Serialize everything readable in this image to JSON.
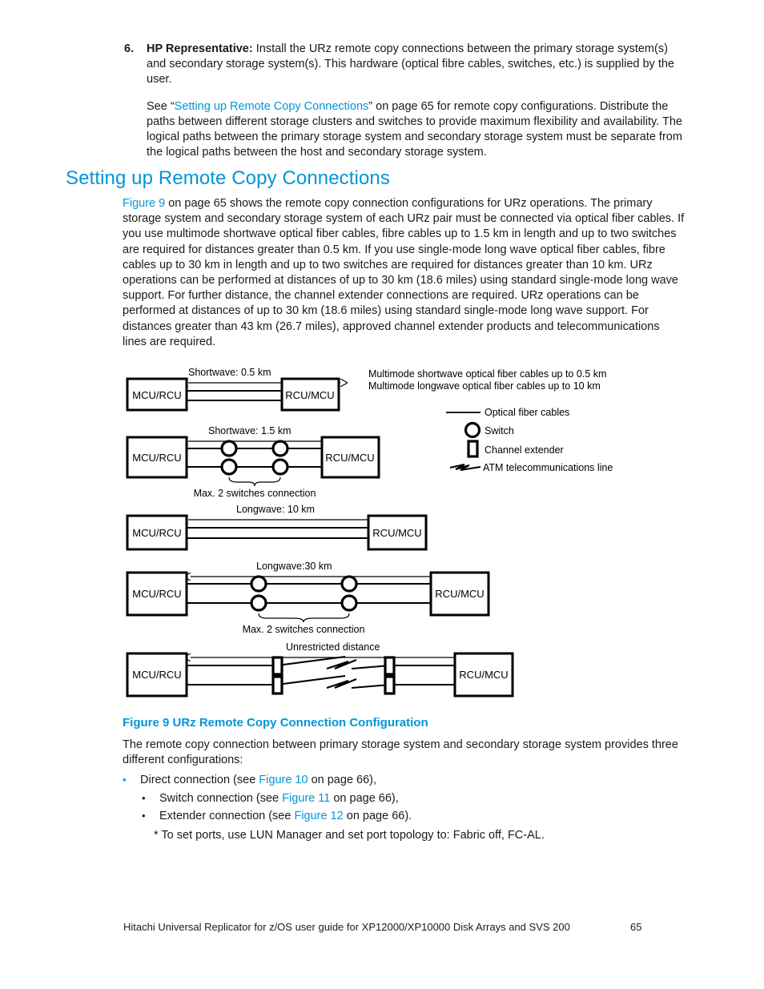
{
  "document": {
    "page_number": "65",
    "footer_text": "Hitachi Universal Replicator for z/OS user guide for XP12000/XP10000 Disk Arrays and SVS 200",
    "accent_color": "#0096d6",
    "text_color": "#1a1a1a"
  },
  "step": {
    "number": "6.",
    "lead": "HP Representative:",
    "text": " Install the URz remote copy connections between the primary storage system(s) and secondary storage system(s). This hardware (optical fibre cables, switches, etc.) is supplied by the user.",
    "paragraph_before_link": "See “",
    "link_text": "Setting up Remote Copy Connections",
    "paragraph_after_link": "” on page 65 for remote copy configurations. Distribute the paths between different storage clusters and switches to provide maximum flexibility and availability. The logical paths between the primary storage system and secondary storage system must be separate from the logical paths between the host and secondary storage system."
  },
  "section": {
    "heading": "Setting up Remote Copy Connections",
    "body_link": "Figure 9",
    "body_text": " on page 65 shows the remote copy connection configurations for URz operations. The primary storage system and secondary storage system of each URz pair must be connected via optical fiber cables. If you use multimode shortwave optical fiber cables, fibre cables up to 1.5 km in length and up to two switches are required for distances greater than 0.5 km. If you use single-mode long wave optical fiber cables, fibre cables up to 30 km in length and up to two switches are required for distances greater than 10 km. URz operations can be performed at distances of up to 30 km (18.6 miles) using standard single-mode long wave support. For further distance, the channel extender connections are required. URz operations can be performed at distances of up to 30 km (18.6 miles) using standard single-mode long wave support. For distances greater than 43 km (26.7 miles), approved channel extender products and telecommunications lines are required."
  },
  "figure": {
    "caption": "Figure 9 URz Remote Copy Connection Configuration",
    "left_box_label": "MCU/RCU",
    "right_box_label": "RCU/MCU",
    "notes": [
      "Multimode shortwave optical fiber cables up to 0.5 km",
      "Multimode longwave optical fiber cables up to 10 km"
    ],
    "legend": [
      {
        "symbol": "line",
        "label": "Optical fiber cables"
      },
      {
        "symbol": "circle",
        "label": "Switch"
      },
      {
        "symbol": "rect",
        "label": "Channel extender"
      },
      {
        "symbol": "zigzag",
        "label": "ATM telecommunications line"
      }
    ],
    "configs": [
      {
        "id": "config-1",
        "distance_label": "Shortwave: 0.5 km",
        "sub_label": "",
        "switches": 0,
        "extenders": 0
      },
      {
        "id": "config-2",
        "distance_label": "Shortwave: 1.5 km",
        "sub_label": "Max. 2 switches connection",
        "switches": 2,
        "extenders": 0
      },
      {
        "id": "config-3",
        "distance_label": "Longwave: 10 km",
        "sub_label": "",
        "switches": 0,
        "extenders": 0
      },
      {
        "id": "config-4",
        "distance_label": "Longwave:30 km",
        "sub_label": "Max. 2 switches connection",
        "switches": 2,
        "extenders": 0
      },
      {
        "id": "config-5",
        "distance_label": "Unrestricted distance",
        "sub_label": "",
        "switches": 0,
        "extenders": 2
      }
    ]
  },
  "after_figure": {
    "intro": "The remote copy connection between primary storage system and secondary storage system provides three different configurations:",
    "bullets": [
      {
        "level": 1,
        "marker": "•",
        "before": "Direct connection (see ",
        "link": "Figure 10",
        "after": " on page 66),"
      },
      {
        "level": 2,
        "marker": "•",
        "before": "Switch connection (see ",
        "link": "Figure 11",
        "after": " on page 66),"
      },
      {
        "level": 2,
        "marker": "•",
        "before": "Extender connection (see ",
        "link": "Figure 12",
        "after": " on page 66)."
      }
    ],
    "footnote": "* To set ports, use LUN Manager and set port topology to: Fabric off, FC-AL."
  }
}
